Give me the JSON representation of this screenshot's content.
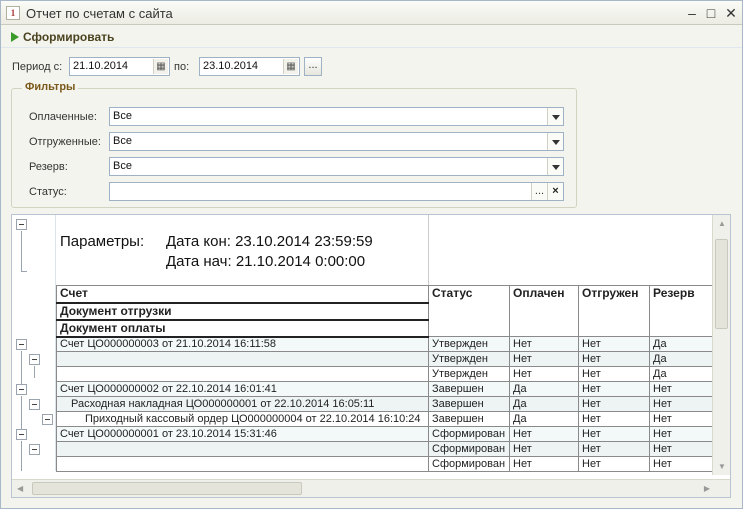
{
  "window": {
    "title": "Отчет по счетам с сайта"
  },
  "toolbar": {
    "form_label": "Сформировать"
  },
  "period": {
    "from_label": "Период с:",
    "from_value": "21.10.2014",
    "to_label": "по:",
    "to_value": "23.10.2014",
    "ellipsis": "..."
  },
  "filters": {
    "title": "Фильтры",
    "paid_label": "Оплаченные:",
    "paid_value": "Все",
    "shipped_label": "Отгруженные:",
    "shipped_value": "Все",
    "reserve_label": "Резерв:",
    "reserve_value": "Все",
    "status_label": "Статус:",
    "status_value": "",
    "status_select_btn": "...",
    "status_clear_btn": "×"
  },
  "report": {
    "params_label": "Параметры:",
    "date_end": "Дата кон: 23.10.2014 23:59:59",
    "date_start": "Дата нач: 21.10.2014 0:00:00",
    "headers": {
      "account": "Счет",
      "shipment_doc": "Документ отгрузки",
      "payment_doc": "Документ оплаты",
      "status": "Статус",
      "paid": "Оплачен",
      "shipped": "Отгружен",
      "reserve": "Резерв"
    },
    "rows": [
      {
        "name": "Счет ЦО000000003 от 21.10.2014 16:11:58",
        "status": "Утвержден",
        "paid": "Нет",
        "shipped": "Нет",
        "reserve": "Да"
      },
      {
        "name": "",
        "status": "Утвержден",
        "paid": "Нет",
        "shipped": "Нет",
        "reserve": "Да"
      },
      {
        "name": "",
        "status": "Утвержден",
        "paid": "Нет",
        "shipped": "Нет",
        "reserve": "Да"
      },
      {
        "name": "Счет ЦО000000002 от 22.10.2014 16:01:41",
        "status": "Завершен",
        "paid": "Да",
        "shipped": "Нет",
        "reserve": "Нет"
      },
      {
        "name": "Расходная накладная ЦО000000001 от 22.10.2014 16:05:11",
        "status": "Завершен",
        "paid": "Да",
        "shipped": "Нет",
        "reserve": "Нет"
      },
      {
        "name": "Приходный кассовый ордер ЦО000000004 от 22.10.2014 16:10:24",
        "status": "Завершен",
        "paid": "Да",
        "shipped": "Нет",
        "reserve": "Нет"
      },
      {
        "name": "Счет ЦО000000001 от 23.10.2014 15:31:46",
        "status": "Сформирован",
        "paid": "Нет",
        "shipped": "Нет",
        "reserve": "Нет"
      },
      {
        "name": "",
        "status": "Сформирован",
        "paid": "Нет",
        "shipped": "Нет",
        "reserve": "Нет"
      },
      {
        "name": "",
        "status": "Сформирован",
        "paid": "Нет",
        "shipped": "Нет",
        "reserve": "Нет"
      }
    ]
  }
}
